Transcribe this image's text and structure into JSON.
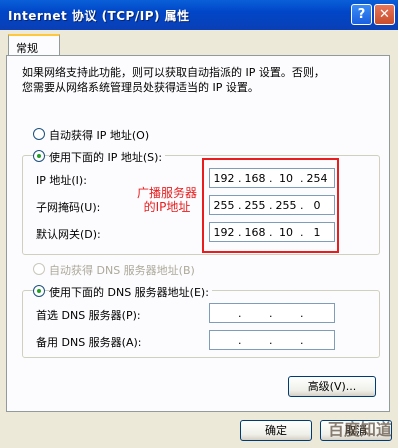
{
  "window": {
    "title": "Internet 协议 (TCP/IP) 属性",
    "help_glyph": "?",
    "close_glyph": "✕"
  },
  "tab": {
    "label": "常规"
  },
  "description": "如果网络支持此功能，则可以获取自动指派的 IP 设置。否则，\n您需要从网络系统管理员处获得适当的 IP 设置。",
  "ip_section": {
    "auto_label": "自动获得 IP 地址(O)",
    "manual_label": "使用下面的 IP 地址(S):",
    "manual_selected": true,
    "fields": [
      {
        "label": "IP 地址(I):",
        "octets": [
          "192",
          "168",
          "10",
          "254"
        ]
      },
      {
        "label": "子网掩码(U):",
        "octets": [
          "255",
          "255",
          "255",
          "0"
        ]
      },
      {
        "label": "默认网关(D):",
        "octets": [
          "192",
          "168",
          "10",
          "1"
        ]
      }
    ]
  },
  "annotation": {
    "line1": "广播服务器",
    "line2": "的IP地址",
    "color": "#e81d1d"
  },
  "dns_section": {
    "auto_label": "自动获得 DNS 服务器地址(B)",
    "manual_label": "使用下面的 DNS 服务器地址(E):",
    "manual_selected": true,
    "fields": [
      {
        "label": "首选 DNS 服务器(P):",
        "octets": [
          "",
          "",
          "",
          ""
        ]
      },
      {
        "label": "备用 DNS 服务器(A):",
        "octets": [
          "",
          "",
          "",
          ""
        ]
      }
    ]
  },
  "buttons": {
    "advanced": "高级(V)...",
    "ok": "确定",
    "cancel": "取消"
  },
  "watermark": "百度知道"
}
